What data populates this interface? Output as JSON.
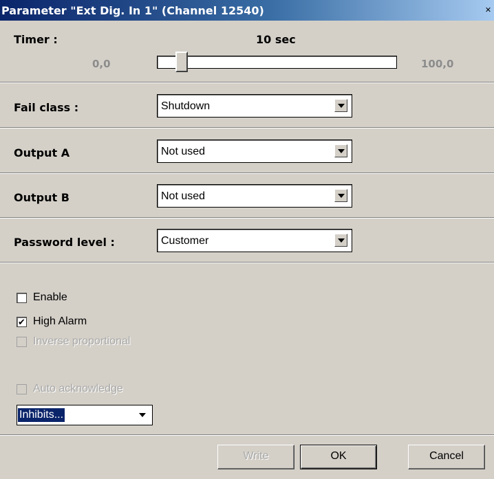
{
  "window": {
    "title": "Parameter \"Ext Dig. In 1\" (Channel 12540)",
    "close_icon": "close-icon"
  },
  "timer": {
    "label": "Timer :",
    "value_text": "10 sec",
    "min_label": "0,0",
    "max_label": "100,0",
    "value": 10,
    "min": 0,
    "max": 100
  },
  "fields": {
    "fail_class": {
      "label": "Fail class :",
      "value": "Shutdown"
    },
    "output_a": {
      "label": "Output A",
      "value": "Not used"
    },
    "output_b": {
      "label": "Output B",
      "value": "Not used"
    },
    "password_level": {
      "label": "Password level :",
      "value": "Customer"
    }
  },
  "checkboxes": {
    "enable": {
      "label": "Enable",
      "checked": false,
      "enabled": true
    },
    "high_alarm": {
      "label": "High Alarm",
      "checked": true,
      "enabled": true
    },
    "inverse_proportional": {
      "label": "Inverse proportional",
      "checked": false,
      "enabled": false
    },
    "auto_acknowledge": {
      "label": "Auto acknowledge",
      "checked": false,
      "enabled": false
    }
  },
  "inhibits": {
    "value": "Inhibits..."
  },
  "buttons": {
    "write": "Write",
    "ok": "OK",
    "cancel": "Cancel"
  },
  "colors": {
    "dialog_bg": "#d4d0c8",
    "title_start": "#0a246a",
    "title_end": "#a6caf0",
    "selection": "#0a246a"
  }
}
